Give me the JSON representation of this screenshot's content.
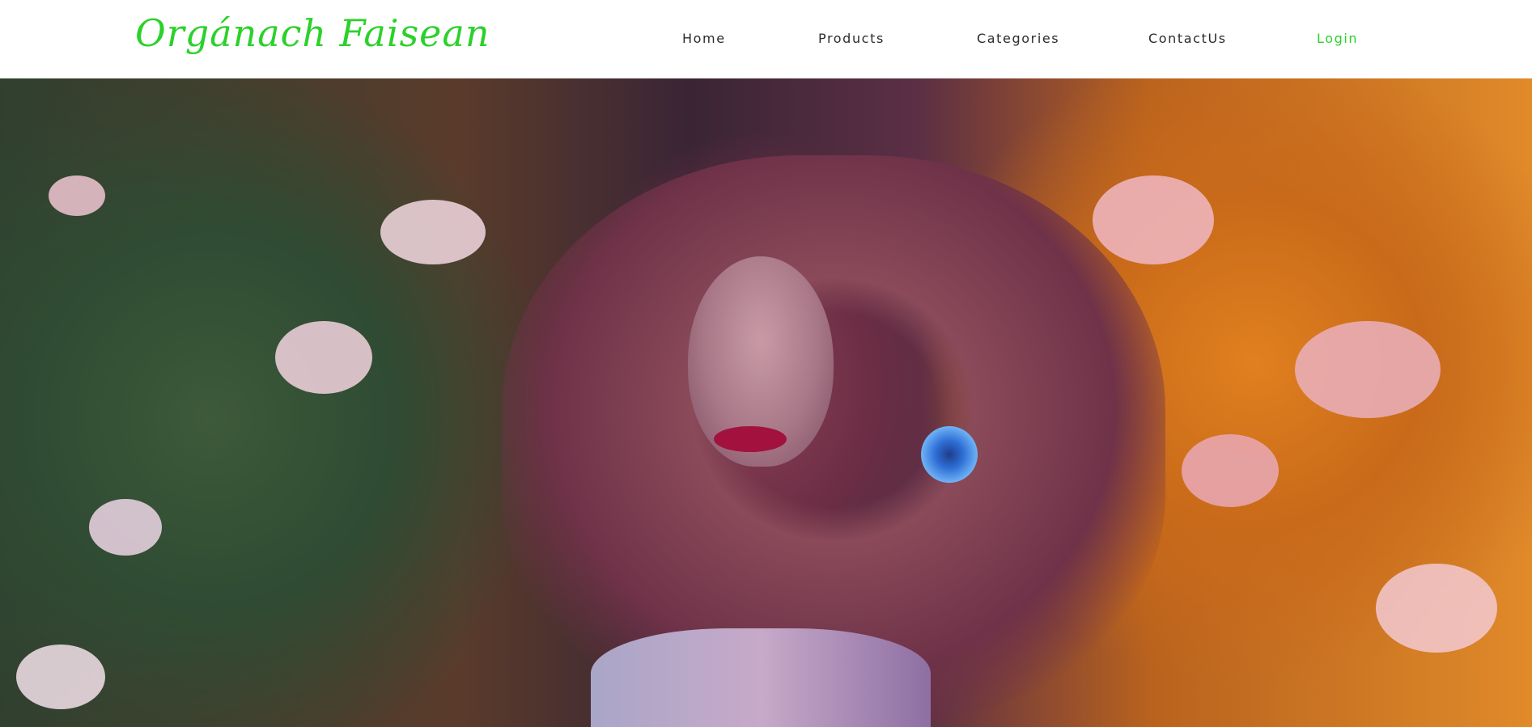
{
  "brand": {
    "logo_text": "Orgánach Faisean",
    "accent_color": "#2bd12b"
  },
  "nav": {
    "items": [
      {
        "label": "Home"
      },
      {
        "label": "Products"
      },
      {
        "label": "Categories"
      },
      {
        "label": "ContactUs"
      },
      {
        "label": "Login"
      }
    ]
  },
  "hero": {
    "image_description_icon": "hero-image"
  }
}
